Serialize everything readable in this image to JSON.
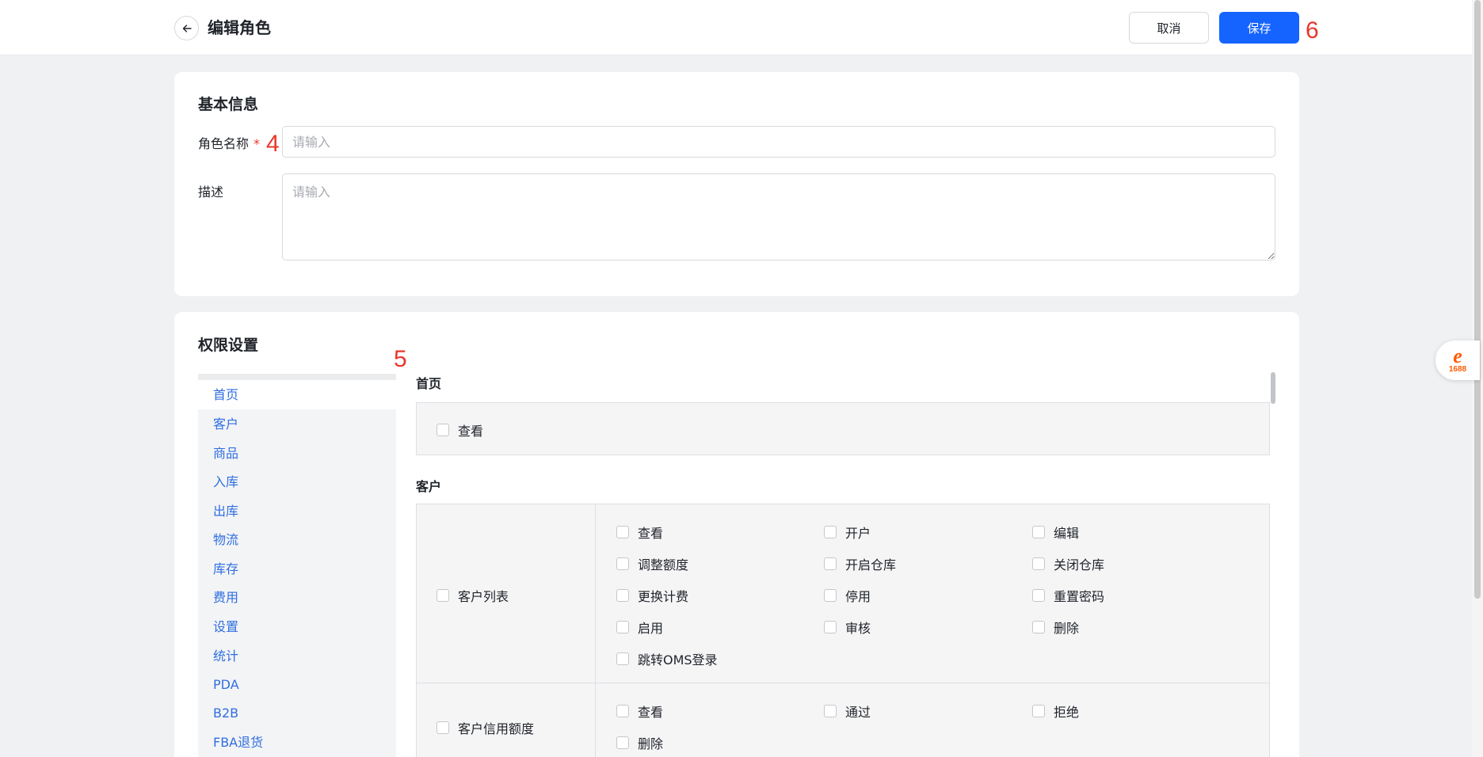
{
  "header": {
    "title": "编辑角色",
    "cancel_label": "取消",
    "save_label": "保存"
  },
  "markers": {
    "m4": "4",
    "m5": "5",
    "m6": "6"
  },
  "basic": {
    "section_title": "基本信息",
    "name_label": "角色名称",
    "required_mark": "*",
    "name_placeholder": "请输入",
    "name_value": "",
    "desc_label": "描述",
    "desc_placeholder": "请输入",
    "desc_value": ""
  },
  "permissions": {
    "section_title": "权限设置",
    "menu": [
      "首页",
      "客户",
      "商品",
      "入库",
      "出库",
      "物流",
      "库存",
      "费用",
      "设置",
      "统计",
      "PDA",
      "B2B",
      "FBA退货"
    ],
    "active_menu": "首页",
    "home": {
      "title": "首页",
      "options": [
        "查看"
      ]
    },
    "customer": {
      "title": "客户",
      "groups": [
        {
          "name": "客户列表",
          "options": [
            "查看",
            "开户",
            "编辑",
            "调整额度",
            "开启仓库",
            "关闭仓库",
            "更换计费",
            "停用",
            "重置密码",
            "启用",
            "审核",
            "删除",
            "跳转OMS登录"
          ]
        },
        {
          "name": "客户信用额度",
          "options": [
            "查看",
            "通过",
            "拒绝",
            "删除"
          ]
        }
      ]
    }
  },
  "floating": {
    "logo_text": "1688",
    "icon": "alibaba-1688-logo-icon"
  },
  "colors": {
    "primary": "#1664ff",
    "link": "#2f6ee0",
    "marker": "#e8372b",
    "required": "#e8372b"
  }
}
